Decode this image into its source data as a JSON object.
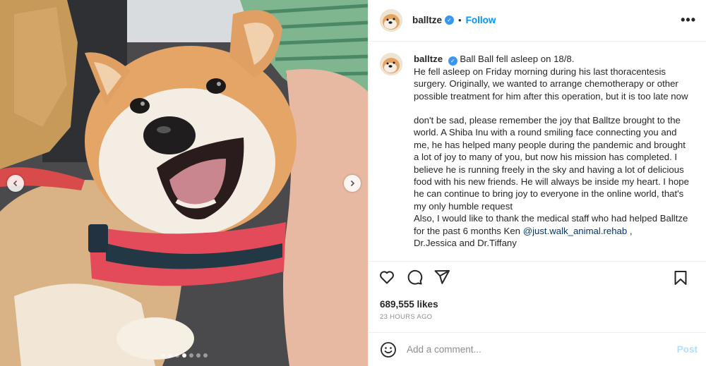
{
  "post": {
    "username": "balltze",
    "follow_label": "Follow",
    "separator": "•",
    "more_label": "•••",
    "caption_username": "balltze",
    "caption_first_line": "Ball Ball fell asleep on 18/8.",
    "caption_p1": "He fell asleep on Friday morning during his last thoracentesis surgery. Originally, we wanted to arrange chemotherapy or other possible treatment for him after this operation, but it is too late now",
    "caption_p2": "don't be sad, please remember the joy that Balltze brought to the world. A Shiba Inu with a round smiling face connecting you and me, he has helped many people during the pandemic and brought a lot of joy to many of you, but now his mission has completed. I believe he is running freely in the sky and having a lot of delicious food with his new friends. He will always be inside my heart. I hope he can continue to bring joy to everyone in the online world, that's my only humble request",
    "caption_p3_before": "Also, I would like to thank the medical staff who had helped Balltze for the past 6 months Ken ",
    "caption_mention": "@just.walk_animal.rehab",
    "caption_p3_after": " ,",
    "caption_p4": "Dr.Jessica and Dr.Tiffany",
    "likes": "689,555 likes",
    "time_ago": "23 HOURS AGO",
    "comment_placeholder": "Add a comment...",
    "post_label": "Post"
  },
  "carousel": {
    "total_slides": 7,
    "active_slide": 4
  },
  "colors": {
    "accent": "#0095f6",
    "verified": "#3897f0",
    "post_disabled": "#b2dffc",
    "muted": "#8e8e8e"
  },
  "icons": [
    "heart-icon",
    "comment-icon",
    "share-icon",
    "bookmark-icon",
    "emoji-icon",
    "verified-icon",
    "more-icon",
    "chevron-left-icon",
    "chevron-right-icon"
  ]
}
